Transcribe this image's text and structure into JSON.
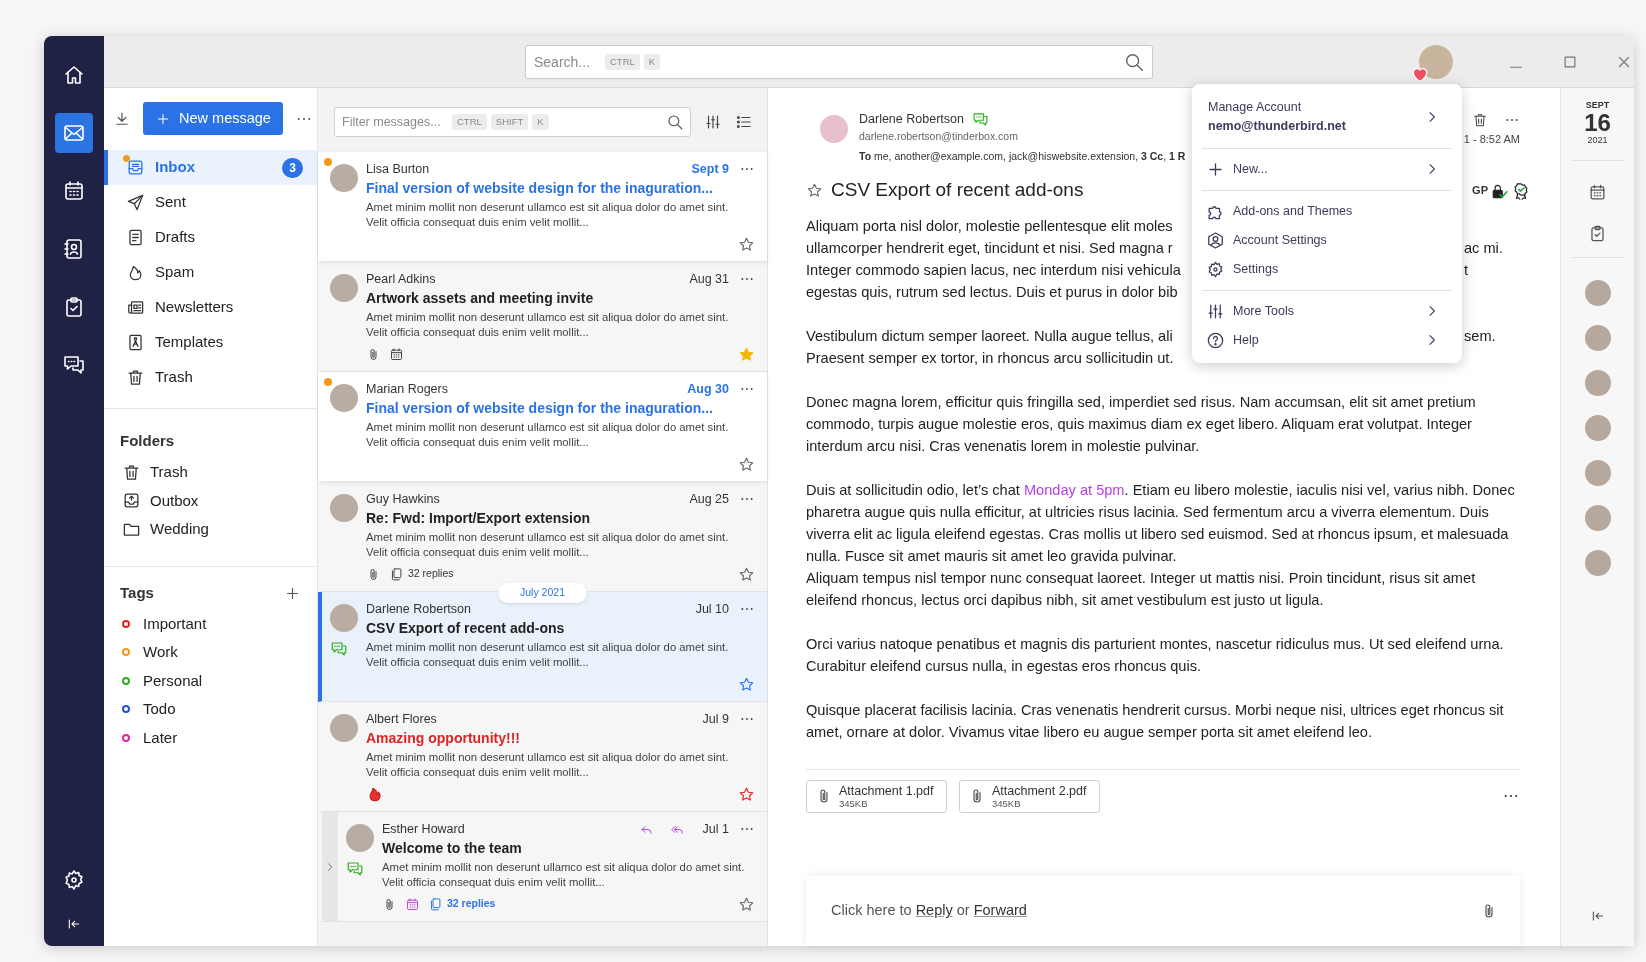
{
  "rail": [
    {
      "kind": "home",
      "selected": false
    },
    {
      "kind": "mail",
      "selected": true
    },
    {
      "kind": "calendar",
      "selected": false
    },
    {
      "kind": "contacts",
      "selected": false
    },
    {
      "kind": "tasks",
      "selected": false
    },
    {
      "kind": "chat",
      "selected": false
    }
  ],
  "search": {
    "placeholder": "Search...",
    "keys": [
      "CTRL",
      "K"
    ]
  },
  "folder_pane": {
    "new_message": "New message",
    "folders": [
      {
        "kind": "inbox",
        "label": "Inbox",
        "count": "3",
        "new": true,
        "selected": true
      },
      {
        "kind": "sent",
        "label": "Sent",
        "new": false,
        "selected": false
      },
      {
        "kind": "drafts",
        "label": "Drafts",
        "new": false,
        "selected": false
      },
      {
        "kind": "spam",
        "label": "Spam",
        "new": false,
        "selected": false
      },
      {
        "kind": "newsletters",
        "label": "Newsletters",
        "new": false,
        "selected": false
      },
      {
        "kind": "templates",
        "label": "Templates",
        "new": false,
        "selected": false
      },
      {
        "kind": "trash",
        "label": "Trash",
        "new": false,
        "selected": false
      }
    ],
    "folders_heading": "Folders",
    "local_folders": [
      {
        "kind": "trash",
        "label": "Trash"
      },
      {
        "kind": "outbox",
        "label": "Outbox"
      },
      {
        "kind": "folder",
        "label": "Wedding"
      }
    ],
    "tags_heading": "Tags",
    "tags": [
      {
        "label": "Important",
        "color": "#e02424"
      },
      {
        "label": "Work",
        "color": "#f39a1e"
      },
      {
        "label": "Personal",
        "color": "#2bb019"
      },
      {
        "label": "Todo",
        "color": "#1f52e0"
      },
      {
        "label": "Later",
        "color": "#e0259e"
      }
    ]
  },
  "message_list": {
    "filter": {
      "placeholder": "Filter messages...",
      "keys": [
        "CTRL",
        "SHIFT",
        "K"
      ]
    },
    "messages": [
      {
        "kind": "message",
        "sender": "Lisa Burton",
        "date": "Sept 9",
        "subject": "Final version of website design for the inaguration...",
        "preview": "Amet minim mollit non deserunt ullamco est sit aliqua dolor do amet sint. Velit officia consequat duis enim velit mollit...",
        "unread": true,
        "starred": false,
        "selected": false,
        "important": false,
        "chat": false,
        "replied": false,
        "forwarded": false
      },
      {
        "kind": "message",
        "sender": "Pearl Adkins",
        "date": "Aug 31",
        "subject": "Artwork assets and meeting invite",
        "preview": "Amet minim mollit non deserunt ullamco est sit aliqua dolor do amet sint. Velit officia consequat duis enim velit mollit...",
        "unread": false,
        "starred": true,
        "selected": false,
        "important": false,
        "chat": false,
        "replied": false,
        "forwarded": false,
        "footer": [
          {
            "kind": "attachment"
          },
          {
            "kind": "calendar",
            "highlighted": false
          }
        ]
      },
      {
        "kind": "message",
        "sender": "Marian Rogers",
        "date": "Aug 30",
        "subject": "Final version of website design for the inaguration...",
        "preview": "Amet minim mollit non deserunt ullamco est sit aliqua dolor do amet sint. Velit officia consequat duis enim velit mollit...",
        "unread": true,
        "starred": false,
        "selected": false,
        "important": false,
        "chat": false,
        "replied": false,
        "forwarded": false
      },
      {
        "kind": "message",
        "sender": "Guy Hawkins",
        "date": "Aug 25",
        "subject": "Re: Fwd: Import/Export extension",
        "preview": "Amet minim mollit non deserunt ullamco est sit aliqua dolor do amet sint. Velit officia consequat duis enim velit mollit...",
        "unread": false,
        "starred": false,
        "selected": false,
        "important": false,
        "chat": false,
        "replied": false,
        "forwarded": false,
        "footer": [
          {
            "kind": "attachment"
          },
          {
            "kind": "thread",
            "label": "32 replies",
            "highlighted": false
          }
        ]
      },
      {
        "kind": "divider",
        "label": "July 2021"
      },
      {
        "kind": "message",
        "sender": "Darlene Robertson",
        "date": "Jul 10",
        "subject": "CSV Export of recent add-ons",
        "preview": "Amet minim mollit non deserunt ullamco est sit aliqua dolor do amet sint. Velit officia consequat duis enim velit mollit...",
        "unread": false,
        "starred": false,
        "selected": true,
        "important": false,
        "chat": true,
        "replied": false,
        "forwarded": false
      },
      {
        "kind": "message",
        "sender": "Albert Flores",
        "date": "Jul 9",
        "subject": "Amazing opportunity!!!",
        "preview": "Amet minim mollit non deserunt ullamco est sit aliqua dolor do amet sint. Velit officia consequat duis enim velit mollit...",
        "unread": false,
        "starred": false,
        "selected": false,
        "important": true,
        "chat": false,
        "replied": false,
        "forwarded": false,
        "footer": [
          {
            "kind": "fire"
          }
        ]
      },
      {
        "kind": "message",
        "sender": "Esther Howard",
        "date": "Jul 1",
        "subject": "Welcome to the team",
        "preview": "Amet minim mollit non deserunt ullamco est sit aliqua dolor do amet sint. Velit officia consequat duis enim velit mollit...",
        "unread": false,
        "starred": false,
        "selected": false,
        "important": false,
        "chat": true,
        "replied": true,
        "forwarded": true,
        "thread": {
          "expanded": false
        },
        "footer": [
          {
            "kind": "attachment"
          },
          {
            "kind": "calendar",
            "highlighted": true
          },
          {
            "kind": "thread",
            "label": "32 replies",
            "highlighted": true
          }
        ]
      }
    ]
  },
  "reader": {
    "sender": "Darlene Robertson",
    "email": "darlene.robertson@tinderbox.com",
    "chat": true,
    "recipients": "**To** me, another@example.com, jack@hiswebsite.extension, **3 Cc**, **1 R**",
    "time": "1 - 8:52 AM",
    "security_label": "GP",
    "subject": "CSV Export of recent add-ons",
    "starred": false,
    "body": [
      {
        "kind": "cut",
        "lines": [
          {
            "left": "Aliquam porta nisl dolor, molestie pellentesque elit moles"
          },
          {
            "left": "ullamcorper hendrerit eget, tincidunt et nisi. Sed magna r",
            "right": "ac mi."
          },
          {
            "left": "Integer commodo sapien lacus, nec interdum nisi vehicula",
            "right": "t"
          },
          {
            "left": "egestas quis, rutrum sed lectus. Duis et purus in dolor bib"
          }
        ]
      },
      {
        "kind": "cut",
        "lines": [
          {
            "left": "Vestibulum dictum semper laoreet. Nulla augue tellus, ali",
            "right": "sem."
          },
          {
            "left": "Praesent semper ex tortor, in rhoncus arcu sollicitudin ut."
          }
        ]
      },
      {
        "kind": "text",
        "parts": [
          {
            "text": "Donec magna lorem, efficitur quis fringilla sed, imperdiet sed risus. Nam accumsan, elit sit amet pretium commodo, turpis augue molestie eros, quis maximus diam ex eget libero. Aliquam erat volutpat. Integer interdum arcu nisi. Cras venenatis lorem in molestie pulvinar."
          }
        ]
      },
      {
        "kind": "text",
        "parts": [
          {
            "text": "Duis at sollicitudin odio, let’s chat "
          },
          {
            "text": "Monday at 5pm",
            "link": true
          },
          {
            "text": ". Etiam eu libero molestie, iaculis nisi vel, varius nibh. Donec pharetra augue quis nulla efficitur, at ultricies risus lacinia. Sed fermentum arcu a viverra elementum. Duis viverra elit ac ligula eleifend egestas. Cras mollis ut libero sed euismod. Sed at rhoncus ipsum, et malesuada nulla. Fusce sit amet mauris sit amet leo gravida pulvinar."
          },
          {
            "text": "Aliquam tempus nisl tempor nunc consequat laoreet. Integer ut mattis nisi. Proin tincidunt, risus sit amet eleifend rhoncus, lectus orci dapibus nibh, sit amet vestibulum est justo ut ligula.",
            "newline": true
          }
        ]
      },
      {
        "kind": "text",
        "parts": [
          {
            "text": "Orci varius natoque penatibus et magnis dis parturient montes, nascetur ridiculus mus. Ut sed eleifend urna. Curabitur eleifend cursus nulla, in egestas eros rhoncus quis."
          }
        ]
      },
      {
        "kind": "text",
        "parts": [
          {
            "text": "Quisque placerat facilisis lacinia. Cras venenatis hendrerit cursus. Morbi neque nisi, ultrices eget rhoncus sit amet, ornare at dolor. Vivamus vitae libero eu augue semper porta sit amet eleifend leo."
          }
        ]
      }
    ],
    "attachments": [
      {
        "name": "Attachment 1.pdf",
        "size": "345KB"
      },
      {
        "name": "Attachment 2.pdf",
        "size": "345KB"
      }
    ],
    "reply_bar": [
      {
        "text": "Click here to "
      },
      {
        "text": "Reply",
        "link": true
      },
      {
        "text": " or "
      },
      {
        "text": "Forward",
        "link": true
      }
    ]
  },
  "today": {
    "month": "SEPT",
    "day": "16",
    "year": "2021"
  },
  "account_menu": {
    "heading": "Manage Account",
    "account": "nemo@thunderbird.net",
    "submenu": true,
    "sections": [
      [
        {
          "kind": "plus",
          "label": "New...",
          "submenu": true
        }
      ],
      [
        {
          "kind": "puzzle",
          "label": "Add-ons and Themes",
          "submenu": false
        },
        {
          "kind": "account",
          "label": "Account Settings",
          "submenu": false
        },
        {
          "kind": "gear",
          "label": "Settings",
          "submenu": false
        }
      ],
      [
        {
          "kind": "sliders",
          "label": "More Tools",
          "submenu": true
        },
        {
          "kind": "help",
          "label": "Help",
          "submenu": true
        }
      ]
    ]
  }
}
